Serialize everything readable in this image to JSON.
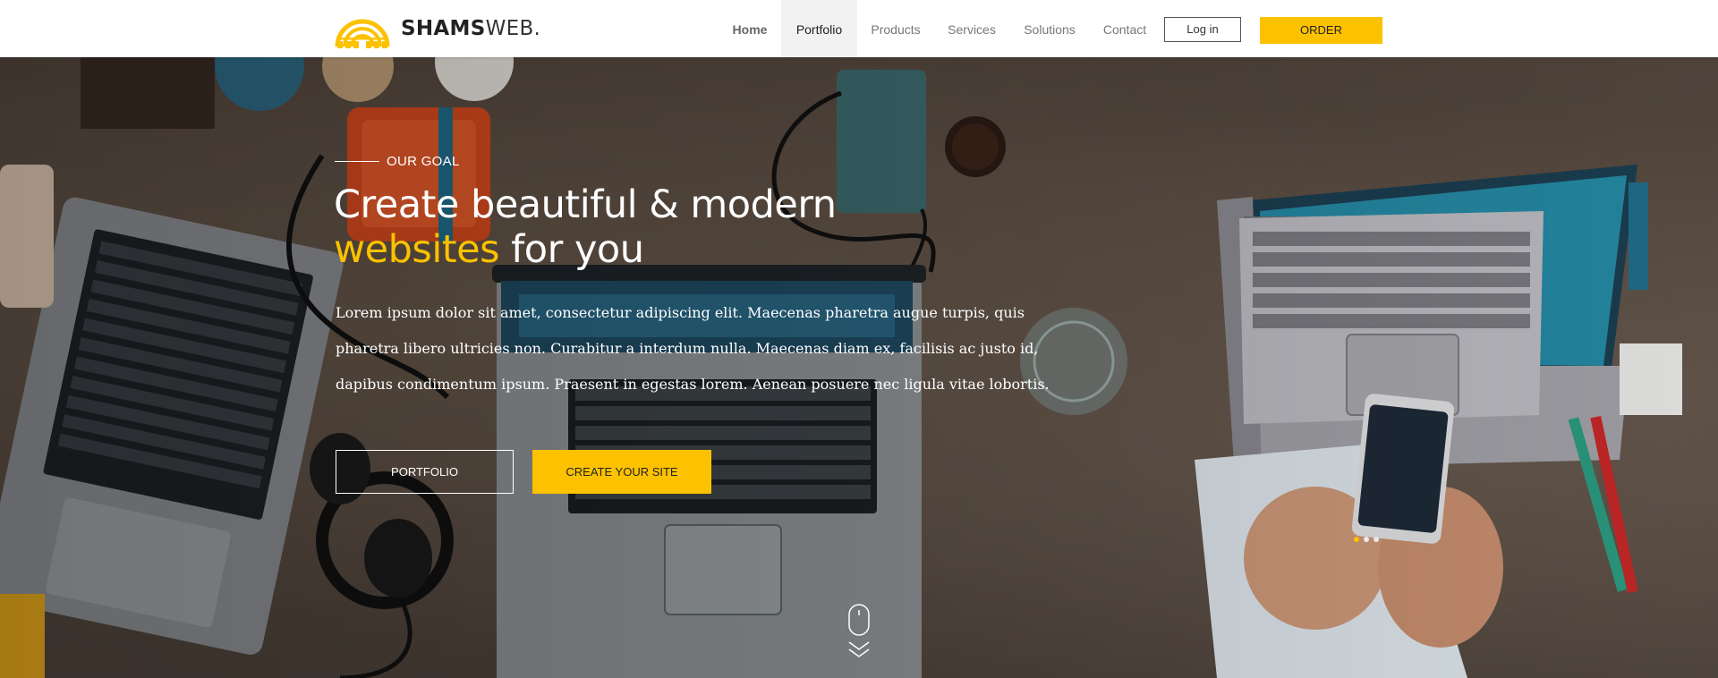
{
  "brand": {
    "name_bold": "SHAMS",
    "name_light": "WEB.",
    "logo_icon": "sun-arch-logo",
    "accent_color": "#fcc200"
  },
  "nav": {
    "items": [
      {
        "label": "Home",
        "state": "bold"
      },
      {
        "label": "Portfolio",
        "state": "active"
      },
      {
        "label": "Products",
        "state": "normal"
      },
      {
        "label": "Services",
        "state": "normal"
      },
      {
        "label": "Solutions",
        "state": "normal"
      },
      {
        "label": "Contact",
        "state": "normal"
      }
    ],
    "login_label": "Log in",
    "order_label": "ORDER"
  },
  "hero": {
    "eyebrow": "OUR GOAL",
    "headline_line1": "Create beautiful & modern",
    "headline_accent": "websites",
    "headline_rest": " for you",
    "description": "Lorem ipsum dolor sit amet, consectetur adipiscing elit. Maecenas pharetra augue turpis, quis pharetra libero ultricies non. Curabitur a interdum nulla. Maecenas diam ex, facilisis ac justo id, dapibus condimentum ipsum. Praesent in egestas lorem. Aenean posuere nec ligula vitae lobortis.",
    "portfolio_button": "PORTFOLIO",
    "create_button": "CREATE YOUR SITE",
    "slider": {
      "count": 3,
      "active_index": 0
    },
    "scroll_icon": "mouse-scroll-icon"
  }
}
